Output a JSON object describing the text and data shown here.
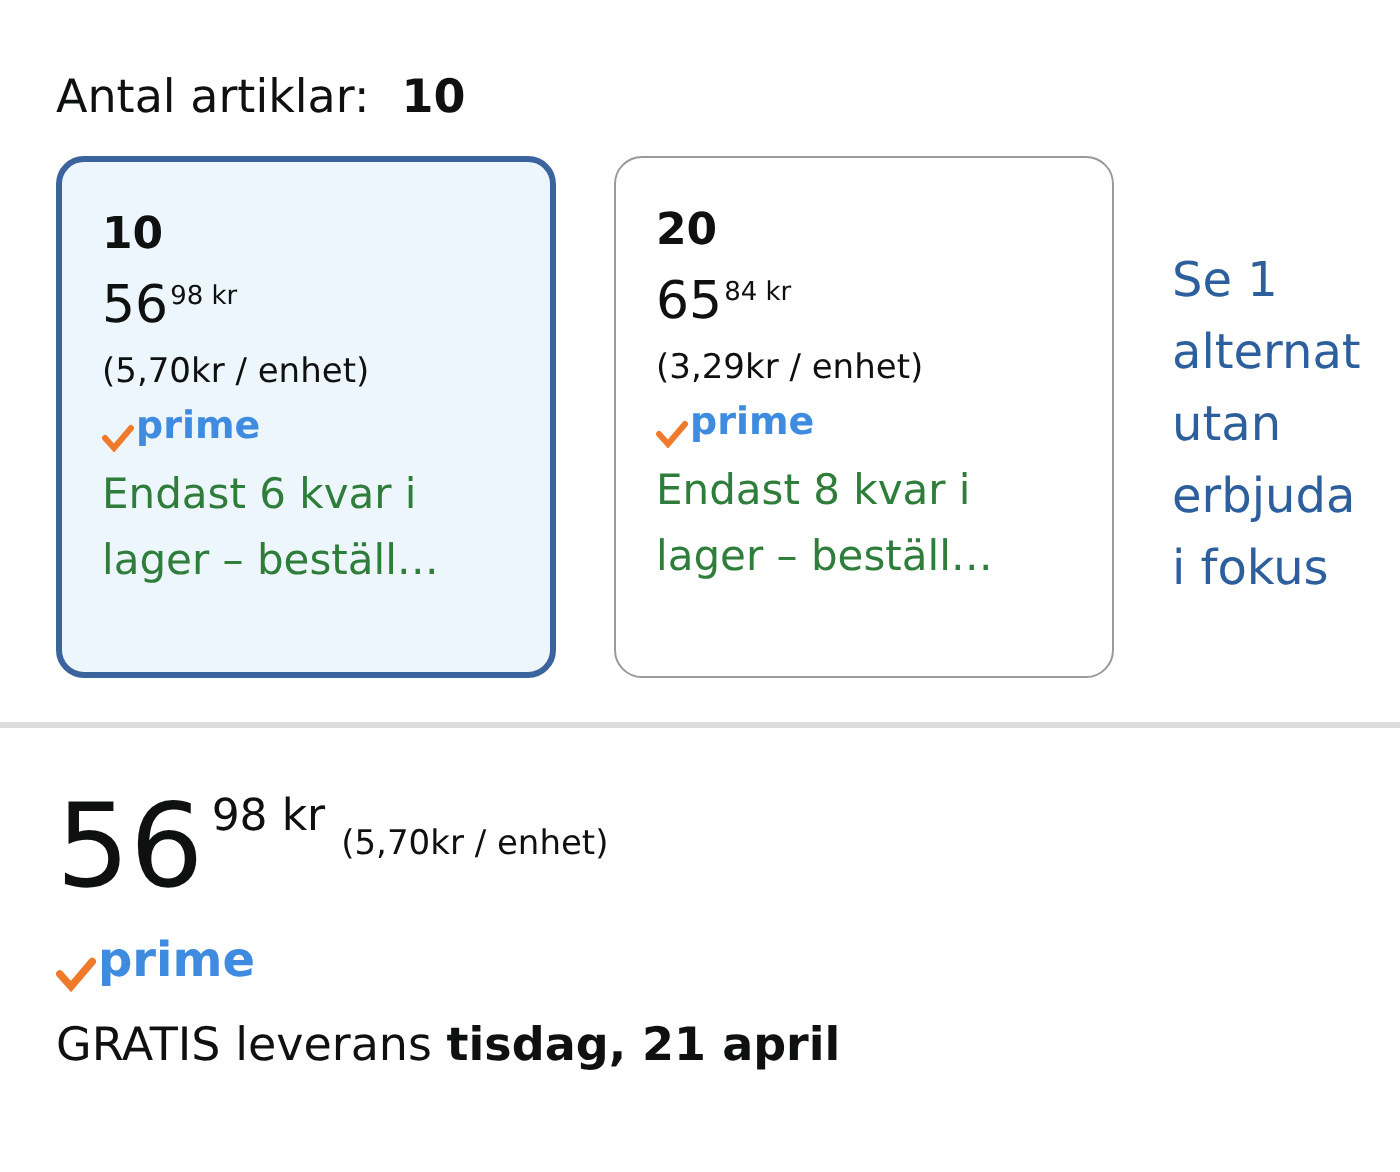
{
  "quantity": {
    "label": "Antal artiklar:",
    "value": "10"
  },
  "options": [
    {
      "count": "10",
      "price_whole": "56",
      "price_fraction": "98",
      "currency": "kr",
      "unit_price": "(5,70kr / enhet)",
      "badge": "prime",
      "stock": "Endast 6 kvar i lager – beställ…",
      "selected": true
    },
    {
      "count": "20",
      "price_whole": "65",
      "price_fraction": "84",
      "currency": "kr",
      "unit_price": "(3,29kr / enhet)",
      "badge": "prime",
      "stock": "Endast 8 kvar i lager – beställ…",
      "selected": false
    }
  ],
  "alternatives_link": [
    "Se 1",
    "alternat",
    "utan",
    "erbjuda",
    "i fokus"
  ],
  "price": {
    "whole": "56",
    "fraction": "98",
    "currency": "kr",
    "unit_price": "(5,70kr / enhet)"
  },
  "badge": "prime",
  "delivery": "GRATIS leverans **tisdag, 21 april**"
}
